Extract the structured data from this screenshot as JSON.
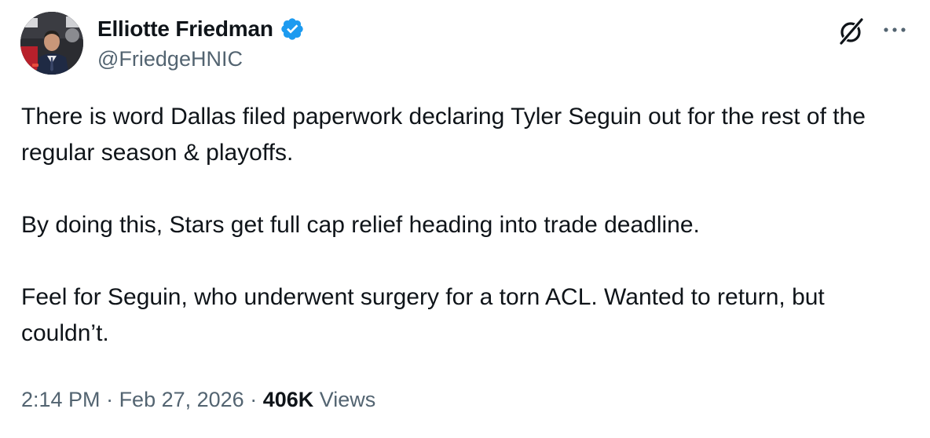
{
  "author": {
    "display_name": "Elliotte Friedman",
    "handle": "@FriedgeHNIC",
    "verified": true
  },
  "tweet": {
    "paragraphs": [
      "There is word Dallas filed paperwork declaring Tyler Seguin out for the rest of the regular season & playoffs.",
      "By doing this, Stars get full cap relief heading into trade deadline.",
      "Feel for Seguin, who underwent surgery for a torn ACL. Wanted to return, but couldn’t."
    ]
  },
  "meta": {
    "time": "2:14 PM",
    "separator": " · ",
    "date": "Feb 27, 2026",
    "views_count": "406K",
    "views_label": " Views"
  },
  "icons": {
    "verified": "verified-badge-icon",
    "grok": "grok-icon",
    "more": "more-horizontal-icon"
  },
  "colors": {
    "text": "#0f1419",
    "secondary": "#536471",
    "verified_blue": "#1d9bf0"
  }
}
